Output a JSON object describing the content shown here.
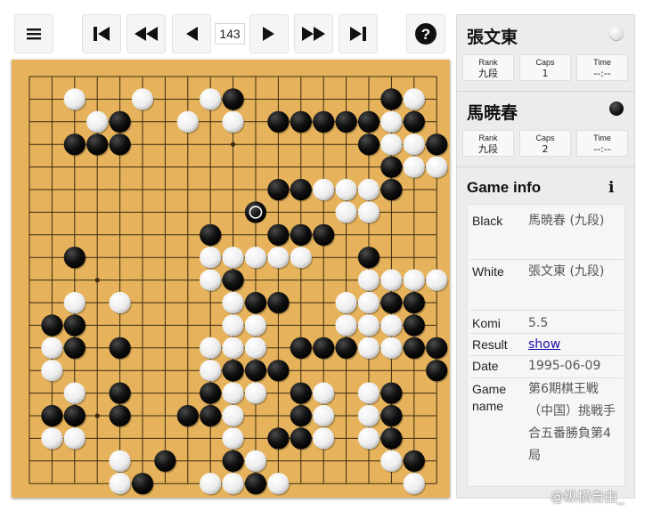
{
  "toolbar": {
    "menu_icon": "hamburger-icon",
    "first_icon": "skip-to-start-icon",
    "back_fast_icon": "fast-backward-icon",
    "back_icon": "step-backward-icon",
    "move_number": "143",
    "forward_icon": "step-forward-icon",
    "forward_fast_icon": "fast-forward-icon",
    "last_icon": "skip-to-end-icon",
    "help_icon": "help-circle-icon"
  },
  "players": [
    {
      "name": "張文東",
      "color": "white",
      "stats": [
        {
          "label": "Rank",
          "value": "九段"
        },
        {
          "label": "Caps",
          "value": "1"
        },
        {
          "label": "Time",
          "value": "--:--"
        }
      ]
    },
    {
      "name": "馬暁春",
      "color": "black",
      "stats": [
        {
          "label": "Rank",
          "value": "九段"
        },
        {
          "label": "Caps",
          "value": "2"
        },
        {
          "label": "Time",
          "value": "--:--"
        }
      ]
    }
  ],
  "game_info": {
    "title": "Game info",
    "icon": "info-icon",
    "rows": [
      {
        "key": "Black",
        "value": "馬暁春 (九段)"
      },
      {
        "key": "White",
        "value": "張文東 (九段)"
      },
      {
        "key": "Komi",
        "value": "5.5"
      },
      {
        "key": "Result",
        "value": "show"
      },
      {
        "key": "Date",
        "value": "1995-06-09"
      },
      {
        "key": "Game name",
        "value": "第6期棋王戦（中国）挑戦手合五番勝負第4局"
      }
    ]
  },
  "board": {
    "size": 19,
    "last_move": [
      6,
      10
    ],
    "rows": [
      "...................",
      "..W..W..WB......BW.",
      "...WB..W.W.BBBBBWB.",
      "..BBB..........BWWBB",
      "................BWWBW",
      "...........BBWWWB..",
      "..............WW...",
      "........B..BBB.....",
      "..B.....WWWWW..B...",
      "........WB.....WWWW",
      "..W.W....WBB..WWBB.",
      ".BB......WW...WWWB.",
      ".WB.B...WWW.BBBWWBB",
      ".W......WBBB......B",
      "..W.B...BWW.BW.WB..",
      ".BB.B..BBW..BW.WB..",
      ".WW......W.BBW.WB..",
      "....W.B..BW.....WB.",
      "....WB..WWBW.....W."
    ]
  },
  "watermark": "@纵横自由_"
}
